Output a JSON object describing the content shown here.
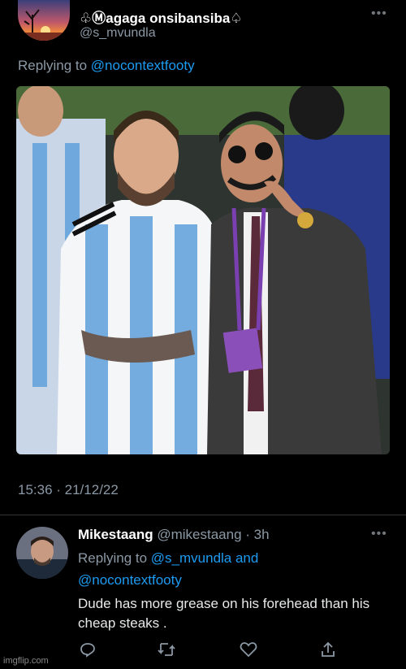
{
  "tweet": {
    "display_name": "♧Ⓜagaga onsibansiba♤",
    "handle": "@s_mvundla",
    "replying_prefix": "Replying to ",
    "replying_to": "@nocontextfooty",
    "timestamp": "15:36 · 21/12/22",
    "more_icon": "more-dots-icon"
  },
  "reply": {
    "display_name": "Mikestaang",
    "handle": "@mikestaang",
    "age": "· 3h",
    "replying_prefix": "Replying to ",
    "replying_to_1": "@s_mvundla",
    "and_text": " and",
    "replying_to_2": "@nocontextfooty",
    "text": "Dude has more grease on his forehead than his cheap  steaks .",
    "actions": [
      "reply-icon",
      "retweet-icon",
      "like-icon",
      "share-icon"
    ]
  },
  "watermark": "imgflip.com",
  "colors": {
    "background": "#000000",
    "link": "#1d9bf0",
    "secondary_text": "#8b98a5",
    "primary_text": "#e7e9ea"
  }
}
